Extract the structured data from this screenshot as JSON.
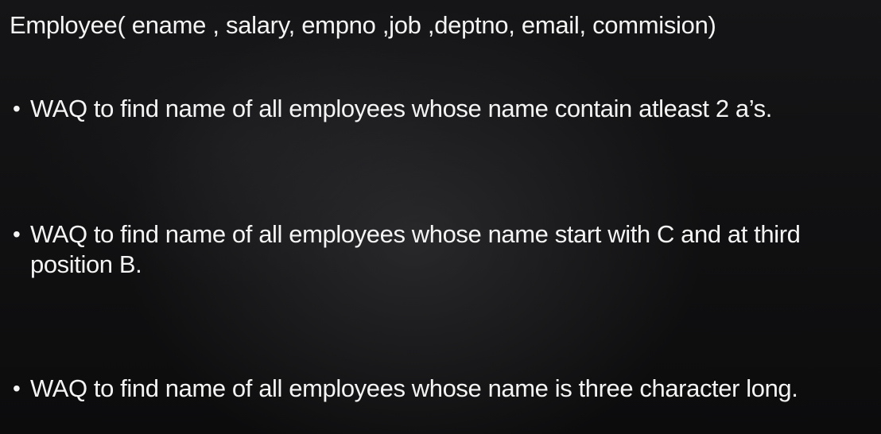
{
  "slide": {
    "title": "Employee( ename , salary, empno ,job ,deptno, email, commision)",
    "bullets": [
      {
        "marker": "•",
        "text": "WAQ to find name of all employees whose name contain atleast 2 a’s."
      },
      {
        "marker": "•",
        "text": "WAQ to find name of all employees whose name start with C and at third position B."
      },
      {
        "marker": "•",
        "text": "WAQ to find name of all employees whose name is three character long."
      }
    ]
  }
}
